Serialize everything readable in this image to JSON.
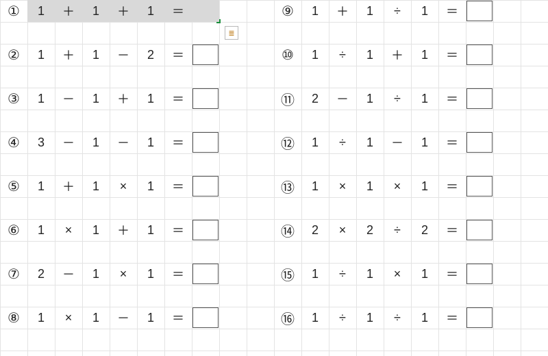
{
  "rows_left": [
    {
      "label": "①",
      "a": "1",
      "op1": "＋",
      "b": "1",
      "op2": "＋",
      "c": "1",
      "eq": "＝",
      "ans": ""
    },
    {
      "label": "②",
      "a": "1",
      "op1": "＋",
      "b": "1",
      "op2": "－",
      "c": "2",
      "eq": "＝",
      "ans": ""
    },
    {
      "label": "③",
      "a": "1",
      "op1": "－",
      "b": "1",
      "op2": "＋",
      "c": "1",
      "eq": "＝",
      "ans": ""
    },
    {
      "label": "④",
      "a": "3",
      "op1": "－",
      "b": "1",
      "op2": "－",
      "c": "1",
      "eq": "＝",
      "ans": ""
    },
    {
      "label": "⑤",
      "a": "1",
      "op1": "＋",
      "b": "1",
      "op2": "×",
      "c": "1",
      "eq": "＝",
      "ans": ""
    },
    {
      "label": "⑥",
      "a": "1",
      "op1": "×",
      "b": "1",
      "op2": "＋",
      "c": "1",
      "eq": "＝",
      "ans": ""
    },
    {
      "label": "⑦",
      "a": "2",
      "op1": "－",
      "b": "1",
      "op2": "×",
      "c": "1",
      "eq": "＝",
      "ans": ""
    },
    {
      "label": "⑧",
      "a": "1",
      "op1": "×",
      "b": "1",
      "op2": "－",
      "c": "1",
      "eq": "＝",
      "ans": ""
    }
  ],
  "rows_right": [
    {
      "label": "⑨",
      "a": "1",
      "op1": "＋",
      "b": "1",
      "op2": "÷",
      "c": "1",
      "eq": "＝",
      "ans": ""
    },
    {
      "label": "⑩",
      "a": "1",
      "op1": "÷",
      "b": "1",
      "op2": "＋",
      "c": "1",
      "eq": "＝",
      "ans": ""
    },
    {
      "label": "⑪",
      "a": "2",
      "op1": "－",
      "b": "1",
      "op2": "÷",
      "c": "1",
      "eq": "＝",
      "ans": ""
    },
    {
      "label": "⑫",
      "a": "1",
      "op1": "÷",
      "b": "1",
      "op2": "－",
      "c": "1",
      "eq": "＝",
      "ans": ""
    },
    {
      "label": "⑬",
      "a": "1",
      "op1": "×",
      "b": "1",
      "op2": "×",
      "c": "1",
      "eq": "＝",
      "ans": ""
    },
    {
      "label": "⑭",
      "a": "2",
      "op1": "×",
      "b": "2",
      "op2": "÷",
      "c": "2",
      "eq": "＝",
      "ans": ""
    },
    {
      "label": "⑮",
      "a": "1",
      "op1": "÷",
      "b": "1",
      "op2": "×",
      "c": "1",
      "eq": "＝",
      "ans": ""
    },
    {
      "label": "⑯",
      "a": "1",
      "op1": "÷",
      "b": "1",
      "op2": "÷",
      "c": "1",
      "eq": "＝",
      "ans": ""
    }
  ],
  "icons": {
    "format": "≣"
  }
}
